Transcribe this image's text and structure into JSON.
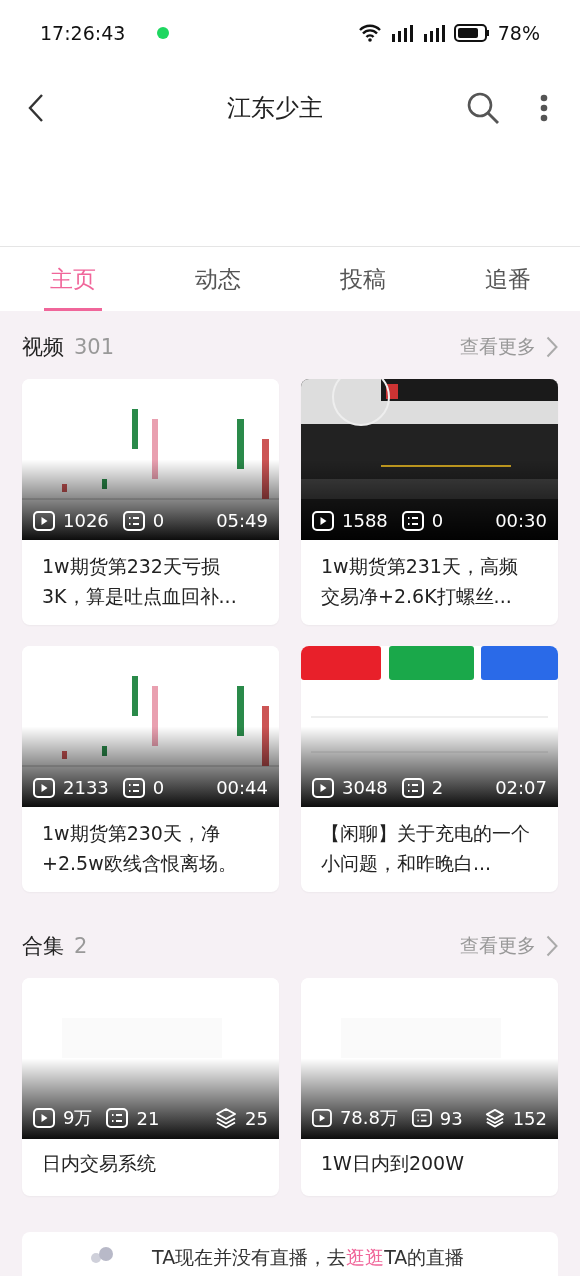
{
  "status_bar": {
    "time": "17:26:43",
    "battery": "78%"
  },
  "header": {
    "title": "江东少主"
  },
  "tabs": [
    {
      "label": "主页",
      "selected": true
    },
    {
      "label": "动态",
      "selected": false
    },
    {
      "label": "投稿",
      "selected": false
    },
    {
      "label": "追番",
      "selected": false
    }
  ],
  "sections": [
    {
      "title": "视频",
      "count": "301",
      "more": "查看更多",
      "items": [
        {
          "kind": "video",
          "views": "1026",
          "comments": "0",
          "duration": "05:49",
          "title": "1w期货第232天亏损3K，算是吐点血回补..."
        },
        {
          "kind": "video",
          "views": "1588",
          "comments": "0",
          "duration": "00:30",
          "title": "1w期货第231天，高频交易净+2.6K打螺丝..."
        },
        {
          "kind": "video",
          "views": "2133",
          "comments": "0",
          "duration": "00:44",
          "title": "1w期货第230天，净+2.5w欧线含恨离场。"
        },
        {
          "kind": "video",
          "views": "3048",
          "comments": "2",
          "duration": "02:07",
          "title": "【闲聊】关于充电的一个小问题，和昨晚白..."
        }
      ]
    },
    {
      "title": "合集",
      "count": "2",
      "more": "查看更多",
      "items": [
        {
          "kind": "collection",
          "views": "9万",
          "comments": "21",
          "episodes": "25",
          "title": "日内交易系统"
        },
        {
          "kind": "collection",
          "views": "78.8万",
          "comments": "93",
          "episodes": "152",
          "title": "1W日内到200W"
        }
      ]
    }
  ],
  "live_notice": {
    "text_before": "TA现在并没有直播，去",
    "link": "逛逛",
    "text_after": "TA的直播"
  }
}
